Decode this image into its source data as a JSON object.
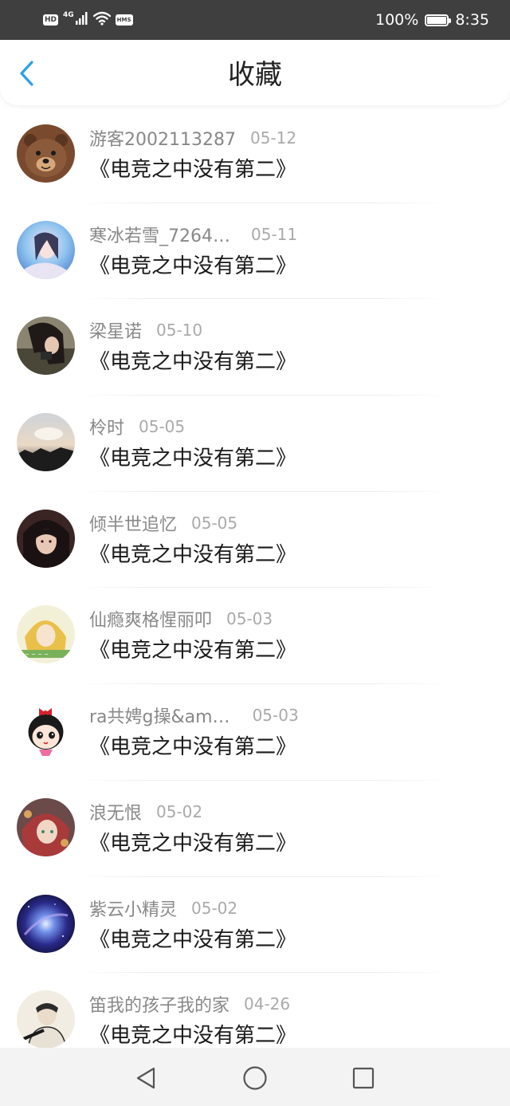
{
  "status_bar": {
    "hd_label": "HD",
    "network_label": "4G",
    "hms_label": "HMS",
    "battery_text": "100%",
    "battery_level": 1.0,
    "time": "8:35"
  },
  "header": {
    "title": "收藏",
    "back_icon": "chevron-left-icon",
    "accent_color": "#2a9fe8"
  },
  "favorites": [
    {
      "user": "游客2002113287",
      "date": "05-12",
      "title": "《电竞之中没有第二》",
      "avatar": "bear-avatar"
    },
    {
      "user": "寒冰若雪_7264…",
      "date": "05-11",
      "title": "《电竞之中没有第二》",
      "avatar": "blue-girl-avatar"
    },
    {
      "user": "梁星诺",
      "date": "05-10",
      "title": "《电竞之中没有第二》",
      "avatar": "dark-girl-avatar"
    },
    {
      "user": "柃时",
      "date": "05-05",
      "title": "《电竞之中没有第二》",
      "avatar": "sky-avatar"
    },
    {
      "user": "倾半世追忆",
      "date": "05-05",
      "title": "《电竞之中没有第二》",
      "avatar": "anime-boy-avatar"
    },
    {
      "user": "仙瘾爽格惺丽叩",
      "date": "05-03",
      "title": "《电竞之中没有第二》",
      "avatar": "yellow-girl-avatar"
    },
    {
      "user": "ra共娉g操&am…",
      "date": "05-03",
      "title": "《电竞之中没有第二》",
      "avatar": "cartoon-girl-avatar"
    },
    {
      "user": "浪无恨",
      "date": "05-02",
      "title": "《电竞之中没有第二》",
      "avatar": "red-hair-avatar"
    },
    {
      "user": "紫云小精灵",
      "date": "05-02",
      "title": "《电竞之中没有第二》",
      "avatar": "galaxy-avatar"
    },
    {
      "user": "笛我的孩子我的家",
      "date": "04-26",
      "title": "《电竞之中没有第二》",
      "avatar": "sketch-avatar"
    }
  ],
  "nav_bar": {
    "back_icon": "triangle-back-icon",
    "home_icon": "circle-home-icon",
    "recents_icon": "square-recents-icon"
  }
}
